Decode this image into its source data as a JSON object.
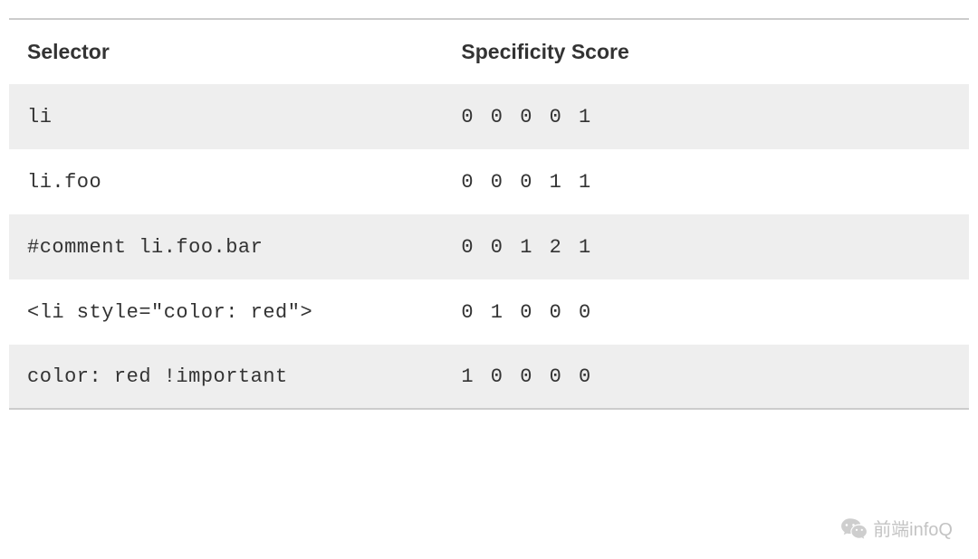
{
  "table": {
    "headers": {
      "selector": "Selector",
      "score": "Specificity Score"
    },
    "rows": [
      {
        "selector": "li",
        "score": "0 0 0 0 1"
      },
      {
        "selector": "li.foo",
        "score": "0 0 0 1 1"
      },
      {
        "selector": "#comment li.foo.bar",
        "score": "0 0 1 2 1"
      },
      {
        "selector": "<li style=\"color: red\">",
        "score": "0 1 0 0 0"
      },
      {
        "selector": "color: red !important",
        "score": "1 0 0 0 0"
      }
    ]
  },
  "watermark": {
    "text": "前端infoQ"
  }
}
